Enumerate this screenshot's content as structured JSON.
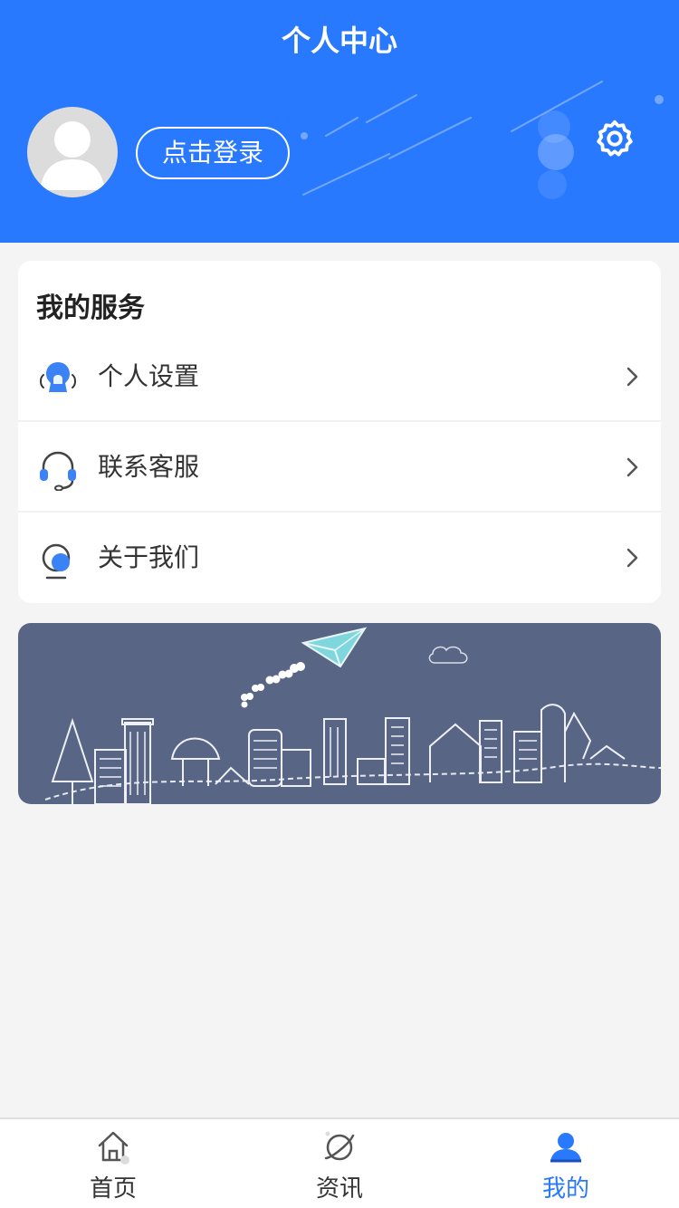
{
  "header": {
    "title": "个人中心",
    "login_label": "点击登录",
    "settings_icon": "gear-icon",
    "avatar_icon": "default-avatar-icon"
  },
  "services": {
    "title": "我的服务",
    "items": [
      {
        "label": "个人设置",
        "icon": "user-settings-icon"
      },
      {
        "label": "联系客服",
        "icon": "headset-icon"
      },
      {
        "label": "关于我们",
        "icon": "info-bubble-icon"
      }
    ]
  },
  "banner": {
    "image": "city-skyline-paper-plane-illustration"
  },
  "tabbar": {
    "items": [
      {
        "label": "首页",
        "icon": "home-icon",
        "active": false
      },
      {
        "label": "资讯",
        "icon": "planet-icon",
        "active": false
      },
      {
        "label": "我的",
        "icon": "user-icon",
        "active": true
      }
    ]
  },
  "colors": {
    "primary": "#2979ff",
    "banner_bg": "#596584",
    "page_bg": "#f4f4f4"
  }
}
